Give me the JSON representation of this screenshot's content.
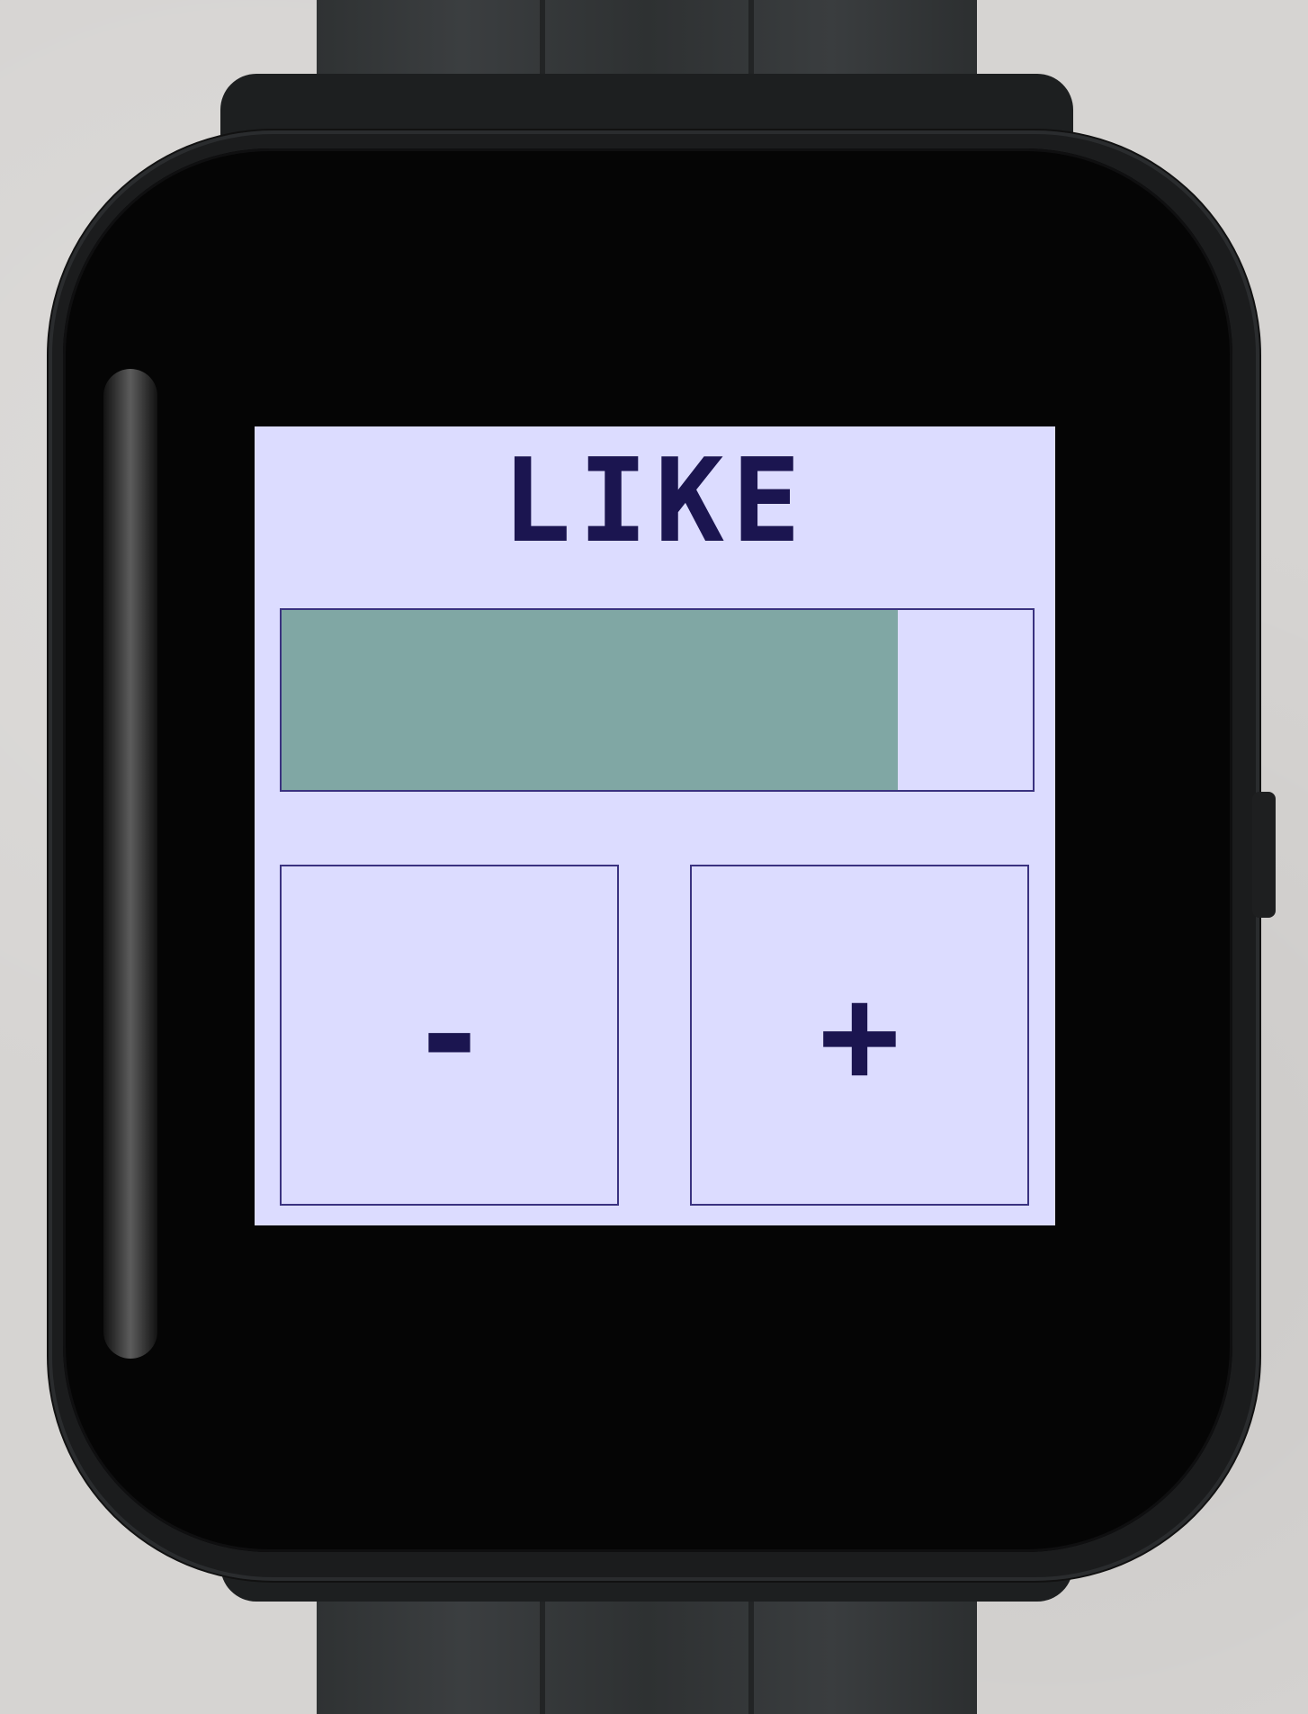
{
  "screen": {
    "title": "LIKE",
    "level": {
      "fraction": 0.82
    },
    "decrement_label": "-",
    "increment_label": "+"
  },
  "colors": {
    "screen_background": "#dcdcff",
    "text": "#1b1550",
    "border": "#3a3280",
    "bar_fill": "#80a7a4"
  }
}
